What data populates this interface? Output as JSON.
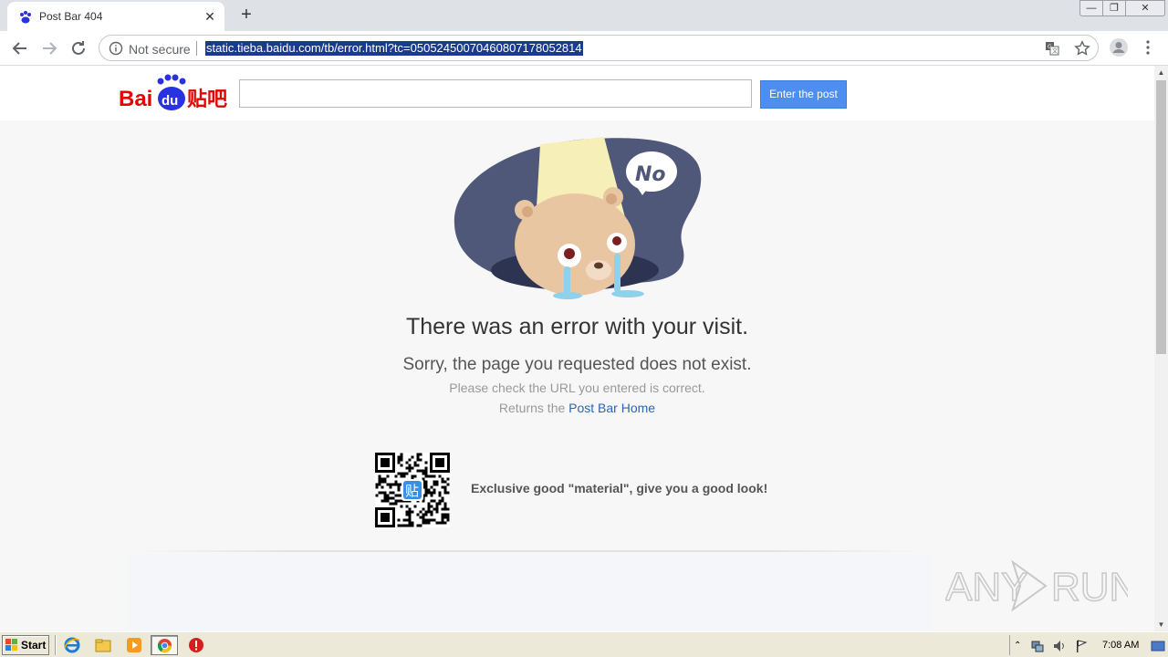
{
  "browser": {
    "tab": {
      "title": "Post Bar 404",
      "close_glyph": "✕",
      "favicon": "baidu-paw-icon"
    },
    "new_tab_glyph": "+",
    "window_controls": {
      "minimize": "—",
      "maximize": "❐",
      "close": "✕"
    },
    "omnibox": {
      "security_label": "Not secure",
      "url": "static.tieba.baidu.com/tb/error.html?tc=05052450070460807178052814"
    },
    "icons": [
      "back-arrow-icon",
      "forward-arrow-icon",
      "reload-icon",
      "info-icon",
      "translate-icon",
      "star-icon",
      "profile-icon",
      "menu-icon"
    ]
  },
  "site": {
    "logo": {
      "text_bai": "Bai",
      "text_du": "du",
      "text_cn": "贴吧"
    },
    "search": {
      "value": "",
      "placeholder": ""
    },
    "enter_button": "Enter the post"
  },
  "error": {
    "bubble_text": "No",
    "title": "There was an error with your visit.",
    "subtitle": "Sorry, the page you requested does not exist.",
    "check": "Please check the URL you entered is correct.",
    "return_prefix": "Returns the ",
    "return_link": "Post Bar Home"
  },
  "qr": {
    "center_glyph": "贴",
    "caption": "Exclusive good \"material\", give you a good look!"
  },
  "watermark": {
    "text_any": "ANY",
    "text_run": "RUN"
  },
  "taskbar": {
    "start_label": "Start",
    "clock": "7:08 AM",
    "apps": [
      "ie-icon",
      "folder-icon",
      "media-player-icon",
      "chrome-icon",
      "stop-icon"
    ]
  },
  "colors": {
    "accent_button": "#4d8ef0",
    "link": "#2d64b3",
    "baidu_red": "#e10601",
    "baidu_blue": "#2932e1",
    "url_highlight": "#1a3a8f"
  }
}
